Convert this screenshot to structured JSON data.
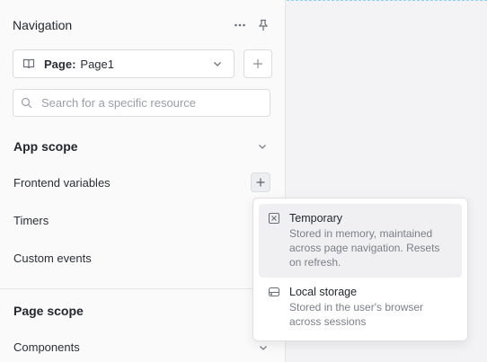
{
  "header": {
    "title": "Navigation",
    "more_icon": "more-horizontal-icon",
    "pin_icon": "pin-icon"
  },
  "page_select": {
    "prefix": "Page:",
    "value": "Page1",
    "icon": "book-icon"
  },
  "search": {
    "placeholder": "Search for a specific resource",
    "value": ""
  },
  "app_scope": {
    "title": "App scope",
    "items": [
      {
        "label": "Frontend variables"
      },
      {
        "label": "Timers"
      },
      {
        "label": "Custom events"
      }
    ]
  },
  "page_scope": {
    "title": "Page scope",
    "items": [
      {
        "label": "Components"
      }
    ]
  },
  "add_menu": {
    "items": [
      {
        "title": "Temporary",
        "description": "Stored in memory, maintained across page navigation. Resets on refresh.",
        "icon": "temporary-x-icon"
      },
      {
        "title": "Local storage",
        "description": "Stored in the user's browser across sessions",
        "icon": "local-storage-icon"
      }
    ]
  },
  "colors": {
    "accent_dashed": "#8ed1f2",
    "panel_bg": "#fafafa",
    "canvas_bg": "#f3f3f5"
  }
}
